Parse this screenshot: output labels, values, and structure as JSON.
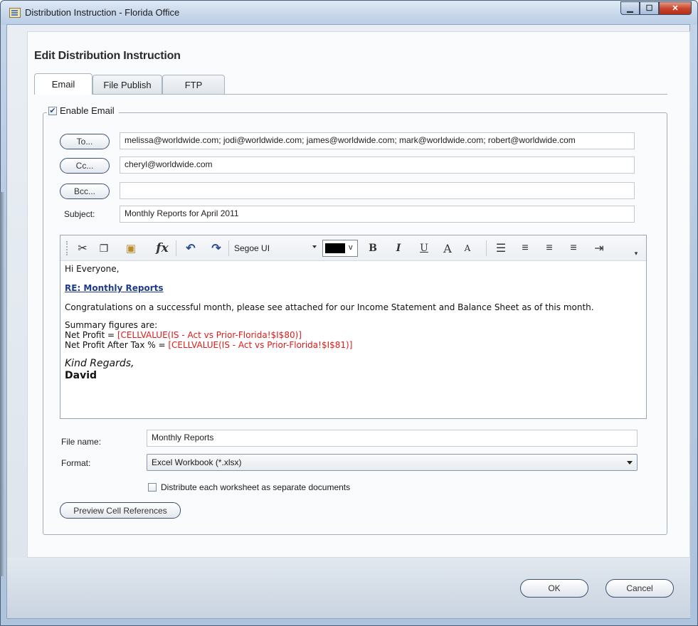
{
  "window": {
    "title": "Distribution Instruction - Florida Office"
  },
  "heading": "Edit Distribution Instruction",
  "tabs": [
    {
      "label": "Email"
    },
    {
      "label": "File Publish"
    },
    {
      "label": "FTP"
    }
  ],
  "email": {
    "enable_label": "Enable Email",
    "enable_checked": true,
    "to_button": "To...",
    "to_value": "melissa@worldwide.com; jodi@worldwide.com; james@worldwide.com; mark@worldwide.com; robert@worldwide.com",
    "cc_button": "Cc...",
    "cc_value": "cheryl@worldwide.com",
    "bcc_button": "Bcc...",
    "bcc_value": "",
    "subject_label": "Subject:",
    "subject_value": "Monthly Reports for April 2011"
  },
  "toolbar": {
    "font_name": "Segoe UI",
    "color_dropdown": "v",
    "bold": "B",
    "italic": "I",
    "underline": "U",
    "grow_font": "A",
    "shrink_font": "A",
    "function": "fx"
  },
  "body": {
    "greeting": "Hi Everyone,",
    "link": "RE: Monthly Reports",
    "paragraph": "Congratulations on a successful month, please see attached for our Income Statement and Balance Sheet as of this month.",
    "summary_heading": "Summary figures are:",
    "net_profit_label": "Net Profit = ",
    "net_profit_ref": "[CELLVALUE(IS - Act vs Prior-Florida!$I$80)]",
    "npat_label": "Net Profit After Tax % = ",
    "npat_ref": "[CELLVALUE(IS - Act vs Prior-Florida!$I$81)]",
    "signoff": "Kind Regards,",
    "signature": "David"
  },
  "attachment": {
    "file_name_label": "File name:",
    "file_name_value": "Monthly Reports",
    "format_label": "Format:",
    "format_value": "Excel Workbook (*.xlsx)",
    "separate_docs_label": "Distribute each worksheet as separate documents",
    "separate_docs_checked": false,
    "preview_button": "Preview Cell References"
  },
  "footer": {
    "ok": "OK",
    "cancel": "Cancel"
  }
}
